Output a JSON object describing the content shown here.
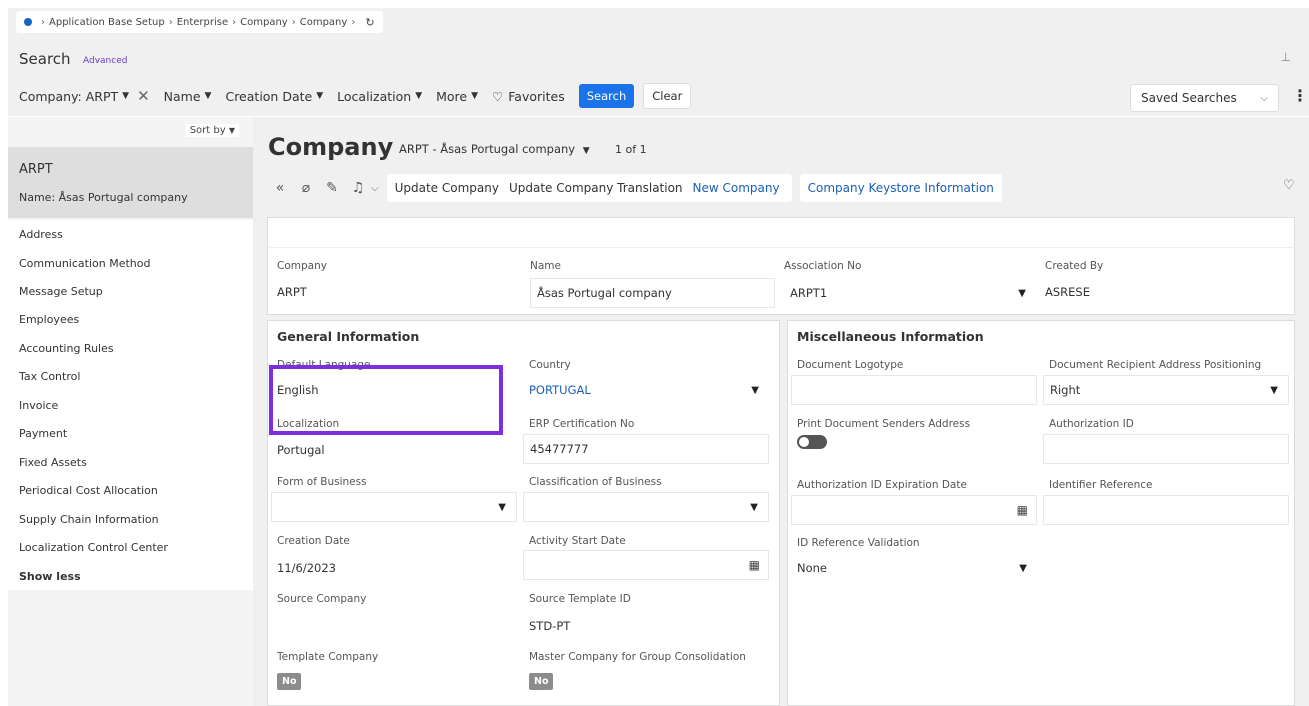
{
  "breadcrumb": {
    "items": [
      "Application Base Setup",
      "Enterprise",
      "Company",
      "Company"
    ],
    "refresh_icon": "refresh-icon"
  },
  "search": {
    "title": "Search",
    "advanced": "Advanced",
    "filters": {
      "company": "Company: ARPT",
      "name": "Name",
      "creation_date": "Creation Date",
      "localization": "Localization",
      "more": "More",
      "favorites": "Favorites"
    },
    "search_button": "Search",
    "clear_button": "Clear",
    "saved_searches": "Saved Searches"
  },
  "sidebar": {
    "sort_by": "Sort by",
    "selected": {
      "title": "ARPT",
      "name": "Name:  Åsas Portugal company"
    },
    "items": [
      "Address",
      "Communication Method",
      "Message Setup",
      "Employees",
      "Accounting Rules",
      "Tax Control",
      "Invoice",
      "Payment",
      "Fixed Assets",
      "Periodical Cost Allocation",
      "Supply Chain Information",
      "Localization Control Center",
      "Show less"
    ]
  },
  "header": {
    "title": "Company",
    "record": "ARPT - Åsas Portugal company",
    "pager": "1 of 1"
  },
  "toolbar": {
    "update_company": "Update Company",
    "update_translation": "Update Company Translation",
    "new_company": "New Company",
    "keystore": "Company Keystore Information"
  },
  "top_fields": {
    "company_label": "Company",
    "company_value": "ARPT",
    "name_label": "Name",
    "name_value": "Åsas Portugal company",
    "assoc_label": "Association No",
    "assoc_value": "ARPT1",
    "created_by_label": "Created By",
    "created_by_value": "ASRESE"
  },
  "general": {
    "title": "General Information",
    "default_language_label": "Default Language",
    "default_language_value": "English",
    "country_label": "Country",
    "country_value": "PORTUGAL",
    "localization_label": "Localization",
    "localization_value": "Portugal",
    "erp_label": "ERP Certification No",
    "erp_value": "45477777",
    "form_label": "Form of Business",
    "classification_label": "Classification of Business",
    "creation_label": "Creation Date",
    "creation_value": "11/6/2023",
    "activity_label": "Activity Start Date",
    "source_company_label": "Source Company",
    "source_template_label": "Source Template ID",
    "source_template_value": "STD-PT",
    "template_company_label": "Template Company",
    "template_company_value": "No",
    "master_label": "Master Company for Group Consolidation",
    "master_value": "No"
  },
  "misc": {
    "title": "Miscellaneous Information",
    "logotype_label": "Document Logotype",
    "recipient_label": "Document Recipient Address Positioning",
    "recipient_value": "Right",
    "print_label": "Print Document Senders Address",
    "auth_id_label": "Authorization ID",
    "auth_exp_label": "Authorization ID Expiration Date",
    "identifier_label": "Identifier Reference",
    "id_validation_label": "ID Reference Validation",
    "id_validation_value": "None"
  },
  "colors": {
    "accent": "#1a73e8",
    "highlight": "#7d2ee0",
    "link": "#1a5fb4"
  }
}
